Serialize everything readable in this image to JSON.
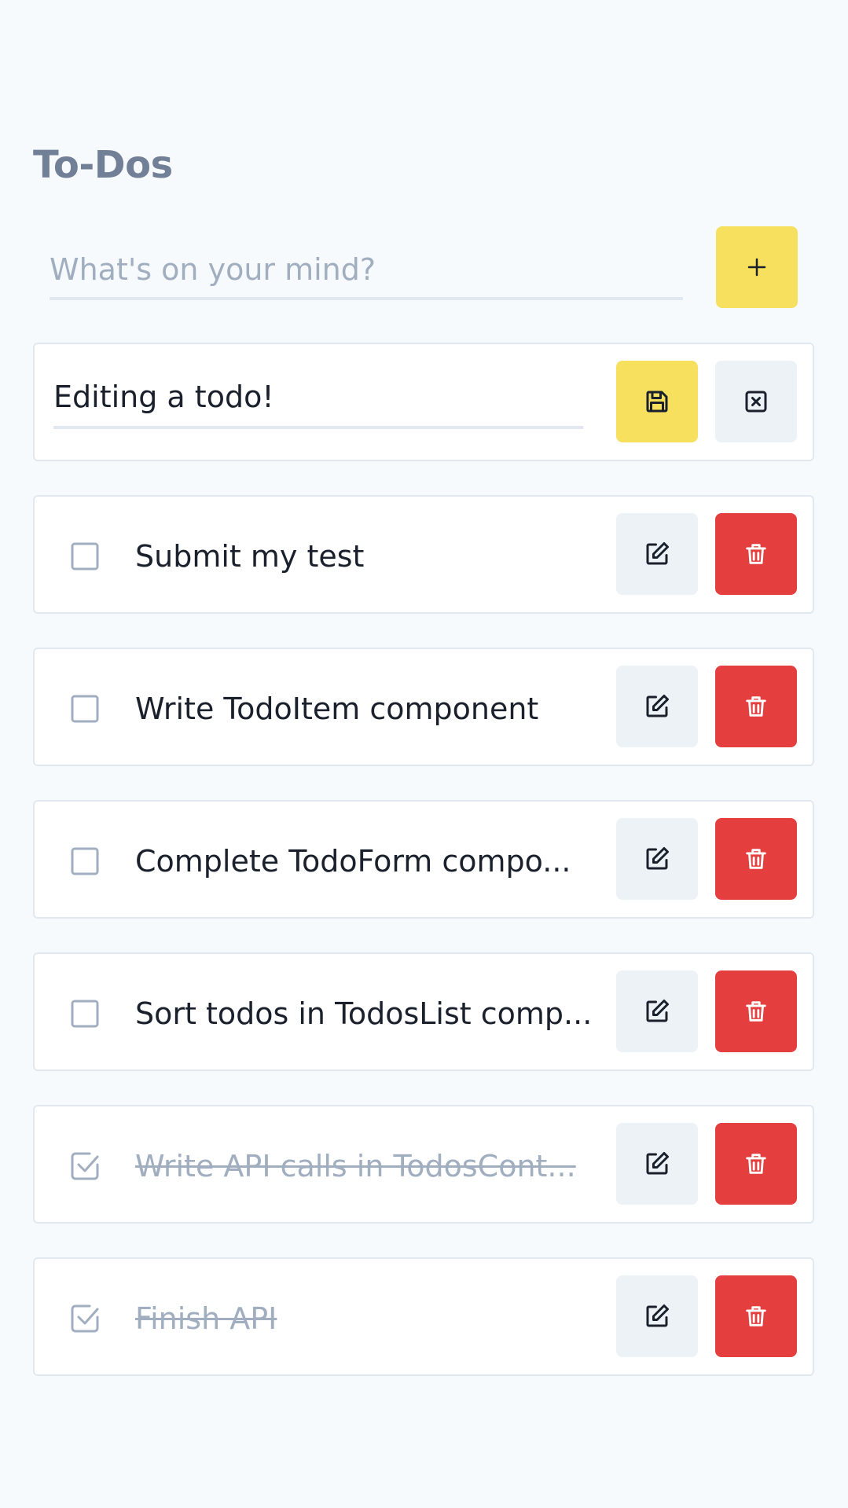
{
  "title": "To-Dos",
  "new_todo": {
    "placeholder": "What's on your mind?",
    "value": ""
  },
  "editing": {
    "value": "Editing a todo!"
  },
  "todos": [
    {
      "text": "Submit my test",
      "completed": false
    },
    {
      "text": "Write TodoItem component",
      "completed": false
    },
    {
      "text": "Complete TodoForm compo...",
      "completed": false
    },
    {
      "text": "Sort todos in TodosList comp...",
      "completed": false
    },
    {
      "text": "Write API calls in TodosCont...",
      "completed": true
    },
    {
      "text": "Finish API",
      "completed": true
    }
  ],
  "icons": {
    "add": "plus-icon",
    "save": "floppy-disk-icon",
    "cancel": "close-square-icon",
    "edit": "edit-icon",
    "delete": "trash-icon",
    "unchecked": "checkbox-unchecked-icon",
    "checked": "checkbox-checked-icon"
  },
  "colors": {
    "background": "#f7fafc",
    "title": "#718096",
    "yellow": "#f6e05e",
    "red": "#e53e3e",
    "gray_button": "#edf2f7",
    "border": "#e2e8f0",
    "muted_text": "#a0aec0"
  }
}
